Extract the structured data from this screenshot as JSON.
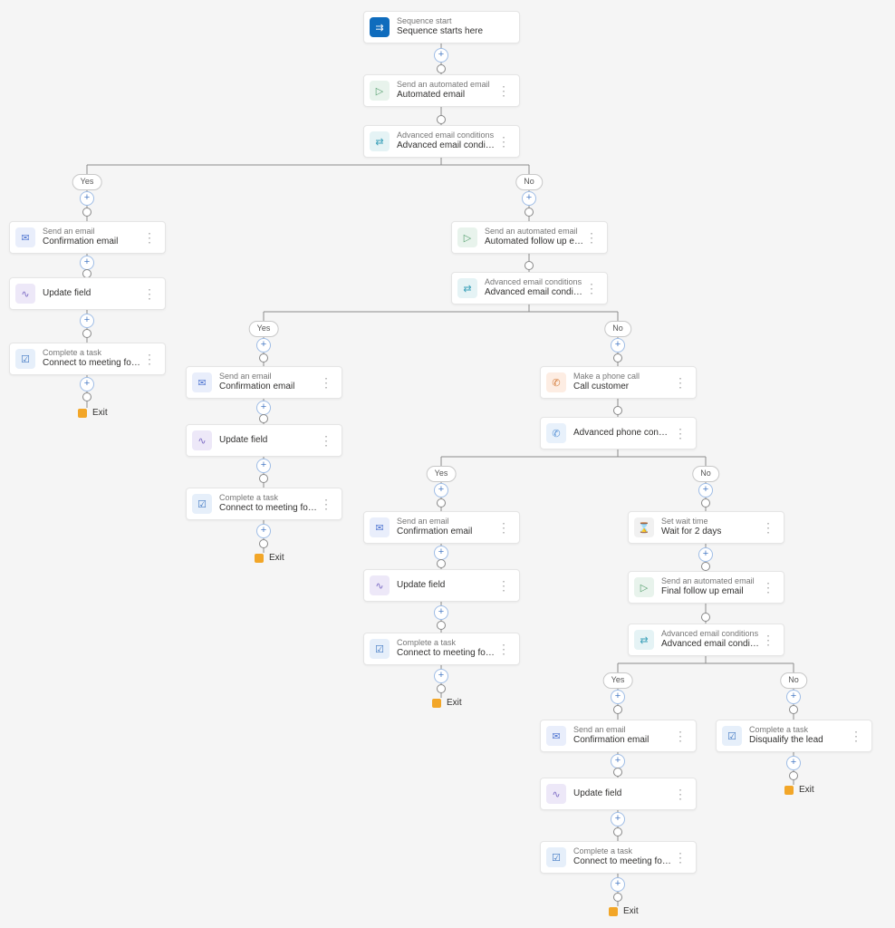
{
  "labels": {
    "yes": "Yes",
    "no": "No",
    "exit": "Exit"
  },
  "steps": {
    "start": {
      "sub": "Sequence start",
      "title": "Sequence starts here"
    },
    "auto1": {
      "sub": "Send an automated email",
      "title": "Automated email"
    },
    "cond1": {
      "sub": "Advanced email conditions",
      "title": "Advanced email conditions"
    },
    "emailA": {
      "sub": "Send an email",
      "title": "Confirmation email"
    },
    "updateA": {
      "sub": "",
      "title": "Update field"
    },
    "taskA": {
      "sub": "Complete a task",
      "title": "Connect to meeting for product demo r..."
    },
    "auto2": {
      "sub": "Send an automated email",
      "title": "Automated follow up email"
    },
    "cond2": {
      "sub": "Advanced email conditions",
      "title": "Advanced email conditions"
    },
    "emailB": {
      "sub": "Send an email",
      "title": "Confirmation email"
    },
    "updateB": {
      "sub": "",
      "title": "Update field"
    },
    "taskB": {
      "sub": "Complete a task",
      "title": "Connect to meeting for product demo r..."
    },
    "phone": {
      "sub": "Make a phone call",
      "title": "Call customer"
    },
    "pcond": {
      "sub": "",
      "title": "Advanced phone condition"
    },
    "emailC": {
      "sub": "Send an email",
      "title": "Confirmation email"
    },
    "updateC": {
      "sub": "",
      "title": "Update field"
    },
    "taskC": {
      "sub": "Complete a task",
      "title": "Connect to meeting for product demo r..."
    },
    "wait": {
      "sub": "Set wait time",
      "title": "Wait for 2 days"
    },
    "auto3": {
      "sub": "Send an automated email",
      "title": "Final follow up email"
    },
    "cond3": {
      "sub": "Advanced email conditions",
      "title": "Advanced email conditions"
    },
    "emailD": {
      "sub": "Send an email",
      "title": "Confirmation email"
    },
    "updateD": {
      "sub": "",
      "title": "Update field"
    },
    "taskD": {
      "sub": "Complete a task",
      "title": "Connect to meeting for product demo r..."
    },
    "disq": {
      "sub": "Complete a task",
      "title": "Disqualify the lead"
    }
  }
}
